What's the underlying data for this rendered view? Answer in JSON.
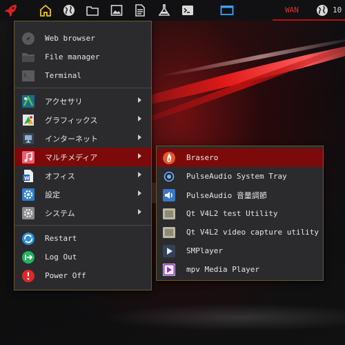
{
  "panel": {
    "icons": [
      "rocket-icon",
      "home-icon",
      "globe-icon",
      "folder-icon",
      "image-icon",
      "document-icon",
      "flask-icon",
      "terminal-icon",
      "workspace-icon"
    ],
    "wan_label": "WAN",
    "net_value": "10"
  },
  "main_menu": {
    "apps": [
      {
        "label": "Web browser",
        "icon": "compass-icon"
      },
      {
        "label": "File manager",
        "icon": "folder-icon"
      },
      {
        "label": "Terminal",
        "icon": "terminal-icon"
      }
    ],
    "categories": [
      {
        "label": "アクセサリ",
        "icon": "accessories-icon"
      },
      {
        "label": "グラフィックス",
        "icon": "graphics-icon"
      },
      {
        "label": "インターネット",
        "icon": "network-icon"
      },
      {
        "label": "マルチメディア",
        "icon": "music-icon"
      },
      {
        "label": "オフィス",
        "icon": "office-icon"
      },
      {
        "label": "設定",
        "icon": "settings-icon"
      },
      {
        "label": "システム",
        "icon": "system-icon"
      }
    ],
    "session": [
      {
        "label": "Restart",
        "icon": "restart-icon"
      },
      {
        "label": "Log Out",
        "icon": "logout-icon"
      },
      {
        "label": "Power Off",
        "icon": "power-icon"
      }
    ]
  },
  "sub_menu": {
    "items": [
      {
        "label": "Brasero",
        "icon": "brasero-icon"
      },
      {
        "label": "PulseAudio System Tray",
        "icon": "pulseaudio-tray-icon"
      },
      {
        "label": "PulseAudio 音量調節",
        "icon": "volume-icon"
      },
      {
        "label": "Qt V4L2 test Utility",
        "icon": "video-utility-icon"
      },
      {
        "label": "Qt V4L2 video capture utility",
        "icon": "video-capture-icon"
      },
      {
        "label": "SMPlayer",
        "icon": "smplayer-icon"
      },
      {
        "label": "mpv Media Player",
        "icon": "mpv-icon"
      }
    ]
  },
  "colors": {
    "accent_red": "#7c0a0a",
    "panel_yellow": "#f0c419",
    "panel_blue": "#3da4ff",
    "menu_bg": "#2b2b2e"
  }
}
